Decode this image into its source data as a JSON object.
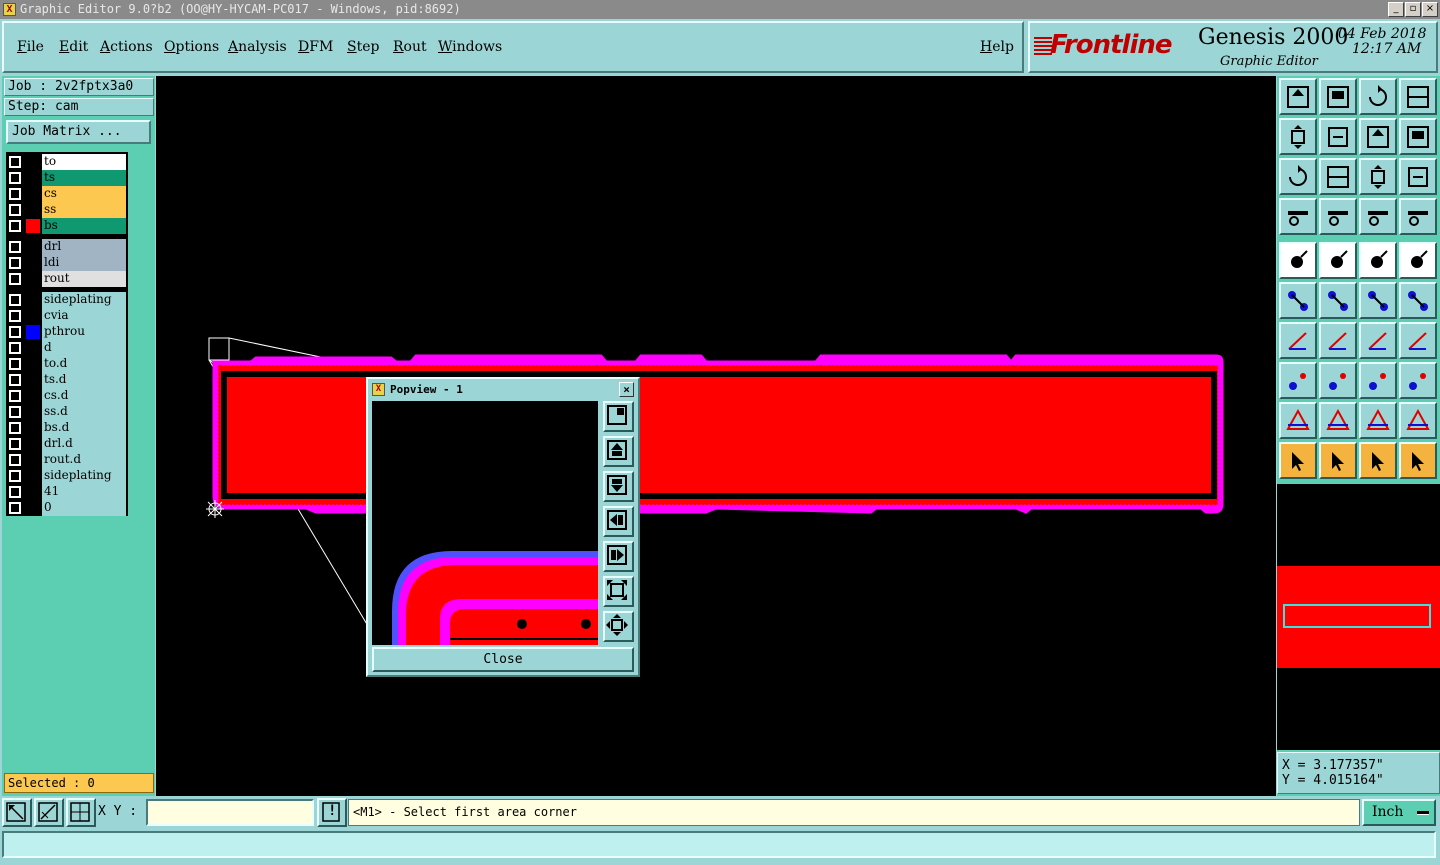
{
  "window": {
    "title": "Graphic Editor 9.0?b2 (OO@HY-HYCAM-PC017 - Windows, pid:8692)",
    "min_label": "_",
    "max_label": "▫",
    "close_label": "×"
  },
  "menu": {
    "items": [
      "File",
      "Edit",
      "Actions",
      "Options",
      "Analysis",
      "DFM",
      "Step",
      "Rout",
      "Windows"
    ],
    "help": "Help"
  },
  "brand": {
    "logo": "Frontline",
    "product": "Genesis 2000",
    "subtitle": "Graphic Editor",
    "date": "04 Feb 2018",
    "time": "12:17 AM"
  },
  "job": {
    "job_line": "Job : 2v2fptx3a0",
    "step_line": "Step: cam",
    "matrix_button": "Job Matrix ..."
  },
  "layers": [
    {
      "name": "to",
      "color": "#ffffff",
      "mark": ""
    },
    {
      "name": "ts",
      "color": "#109870",
      "mark": ""
    },
    {
      "name": "cs",
      "color": "#fcc850",
      "mark": ""
    },
    {
      "name": "ss",
      "color": "#fcc850",
      "mark": ""
    },
    {
      "name": "bs",
      "color": "#109870",
      "mark": "#ff0000"
    },
    {
      "name": "drl",
      "color": "#a0b4c4",
      "mark": ""
    },
    {
      "name": "ldi",
      "color": "#a0b4c4",
      "mark": ""
    },
    {
      "name": "rout",
      "color": "#e0e0e0",
      "mark": ""
    },
    {
      "name": "sideplating",
      "color": "#9cd5d5",
      "mark": ""
    },
    {
      "name": "cvia",
      "color": "#9cd5d5",
      "mark": ""
    },
    {
      "name": "pthrou",
      "color": "#9cd5d5",
      "mark": "#0000ff"
    },
    {
      "name": "d",
      "color": "#9cd5d5",
      "mark": ""
    },
    {
      "name": "to.d",
      "color": "#9cd5d5",
      "mark": ""
    },
    {
      "name": "ts.d",
      "color": "#9cd5d5",
      "mark": ""
    },
    {
      "name": "cs.d",
      "color": "#9cd5d5",
      "mark": ""
    },
    {
      "name": "ss.d",
      "color": "#9cd5d5",
      "mark": ""
    },
    {
      "name": "bs.d",
      "color": "#9cd5d5",
      "mark": ""
    },
    {
      "name": "drl.d",
      "color": "#9cd5d5",
      "mark": ""
    },
    {
      "name": "rout.d",
      "color": "#9cd5d5",
      "mark": ""
    },
    {
      "name": "sideplating",
      "color": "#9cd5d5",
      "mark": ""
    },
    {
      "name": "41",
      "color": "#9cd5d5",
      "mark": ""
    },
    {
      "name": "0",
      "color": "#9cd5d5",
      "mark": ""
    }
  ],
  "selected": "Selected : 0",
  "popview": {
    "title": "Popview - 1",
    "close_button": "Close",
    "tools": [
      "zoom-in-icon",
      "pan-up-icon",
      "pan-down-icon",
      "pan-left-icon",
      "pan-right-icon",
      "fit-icon",
      "zoom-home-icon"
    ]
  },
  "coords": {
    "x": "X = 3.177357\"",
    "y": "Y = 4.015164\""
  },
  "status": {
    "xy_label": "X Y :",
    "xy_value": "",
    "message": "<M1> - Select first area corner",
    "units": "Inch",
    "alert_label": "!"
  },
  "colors": {
    "board": "#ff0000",
    "outline": "#ff00ff",
    "panel": "#9cd5d5",
    "panel_dark": "#5ccfb3",
    "canvas": "#000000"
  }
}
